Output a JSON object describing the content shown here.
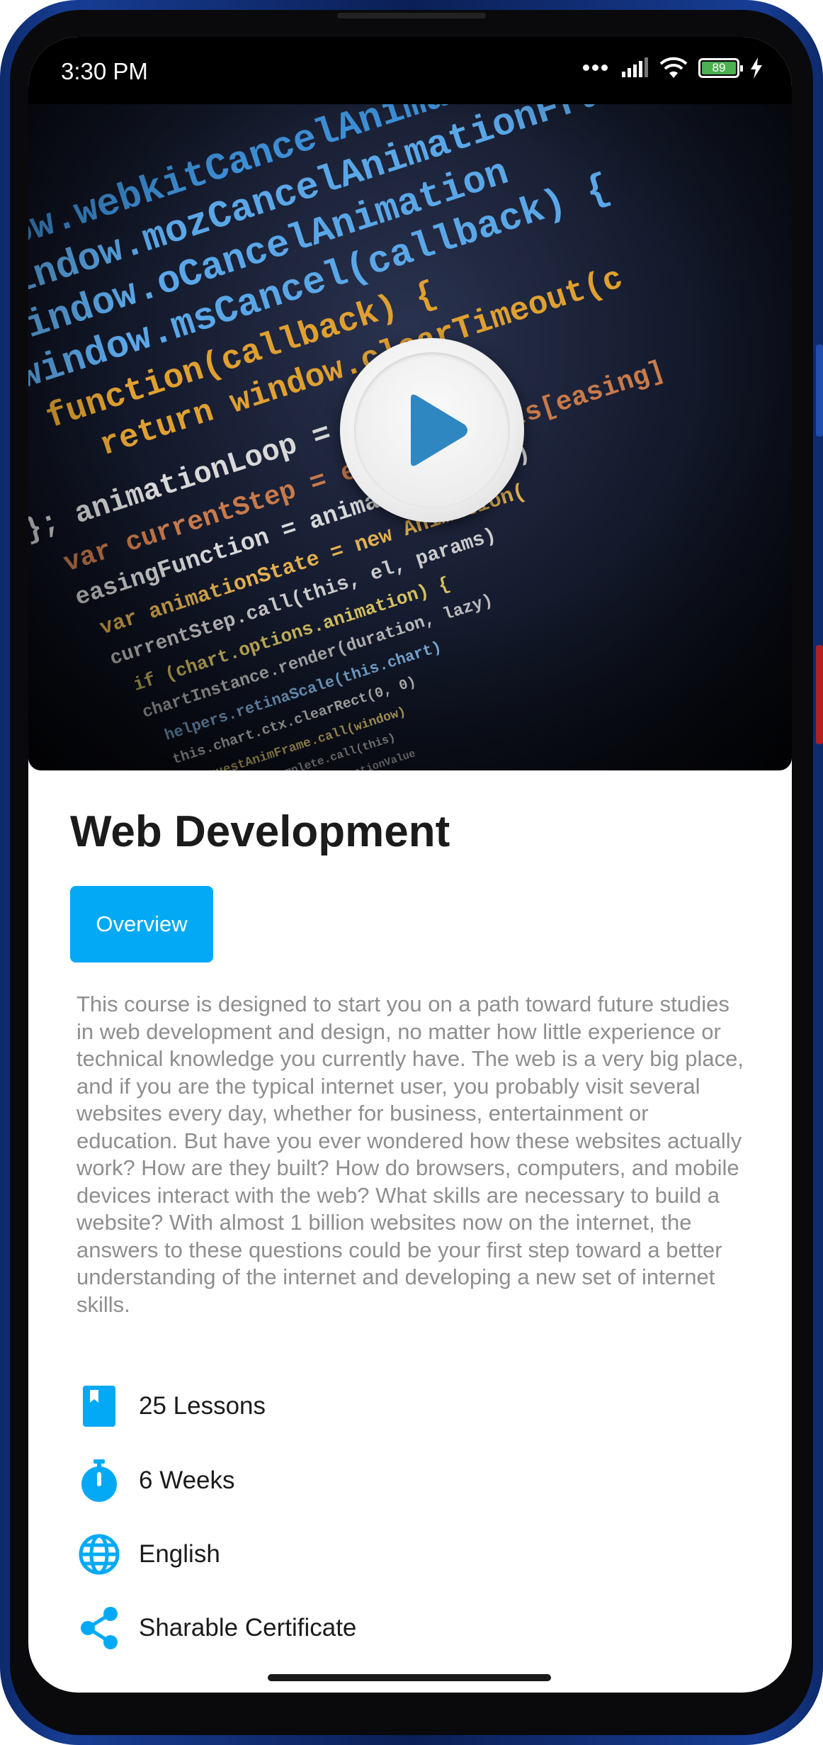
{
  "status_bar": {
    "time": "3:30 PM",
    "battery_level": "89",
    "icons": [
      "more-dots-icon",
      "signal-icon",
      "wifi-icon",
      "battery-icon",
      "charging-icon"
    ]
  },
  "video": {
    "thumbnail": "code-screen-thumbnail",
    "play_icon": "play-icon"
  },
  "course": {
    "title": "Web Development",
    "tab_label": "Overview",
    "description": "This course is designed to start you on a path toward future studies in web development and design, no matter how little experience or technical knowledge you currently have. The web is a very big place, and if you are the typical internet user, you probably visit several websites every day, whether for business, entertainment or education. But have you ever wondered how these websites actually work? How are they built? How do browsers, computers, and mobile devices interact with the web? What skills are necessary to build a website? With almost 1 billion websites now on the internet, the answers to these questions could be your first step toward a better understanding of the internet and developing a new set of internet skills."
  },
  "features": [
    {
      "icon": "book-icon",
      "label": "25 Lessons"
    },
    {
      "icon": "stopwatch-icon",
      "label": "6 Weeks"
    },
    {
      "icon": "globe-icon",
      "label": "English"
    },
    {
      "icon": "share-icon",
      "label": "Sharable Certificate"
    }
  ],
  "colors": {
    "accent": "#03a9f4",
    "title_text": "#1b1b1b",
    "description_text": "#8e8e8e",
    "status_bar": "#000000"
  }
}
